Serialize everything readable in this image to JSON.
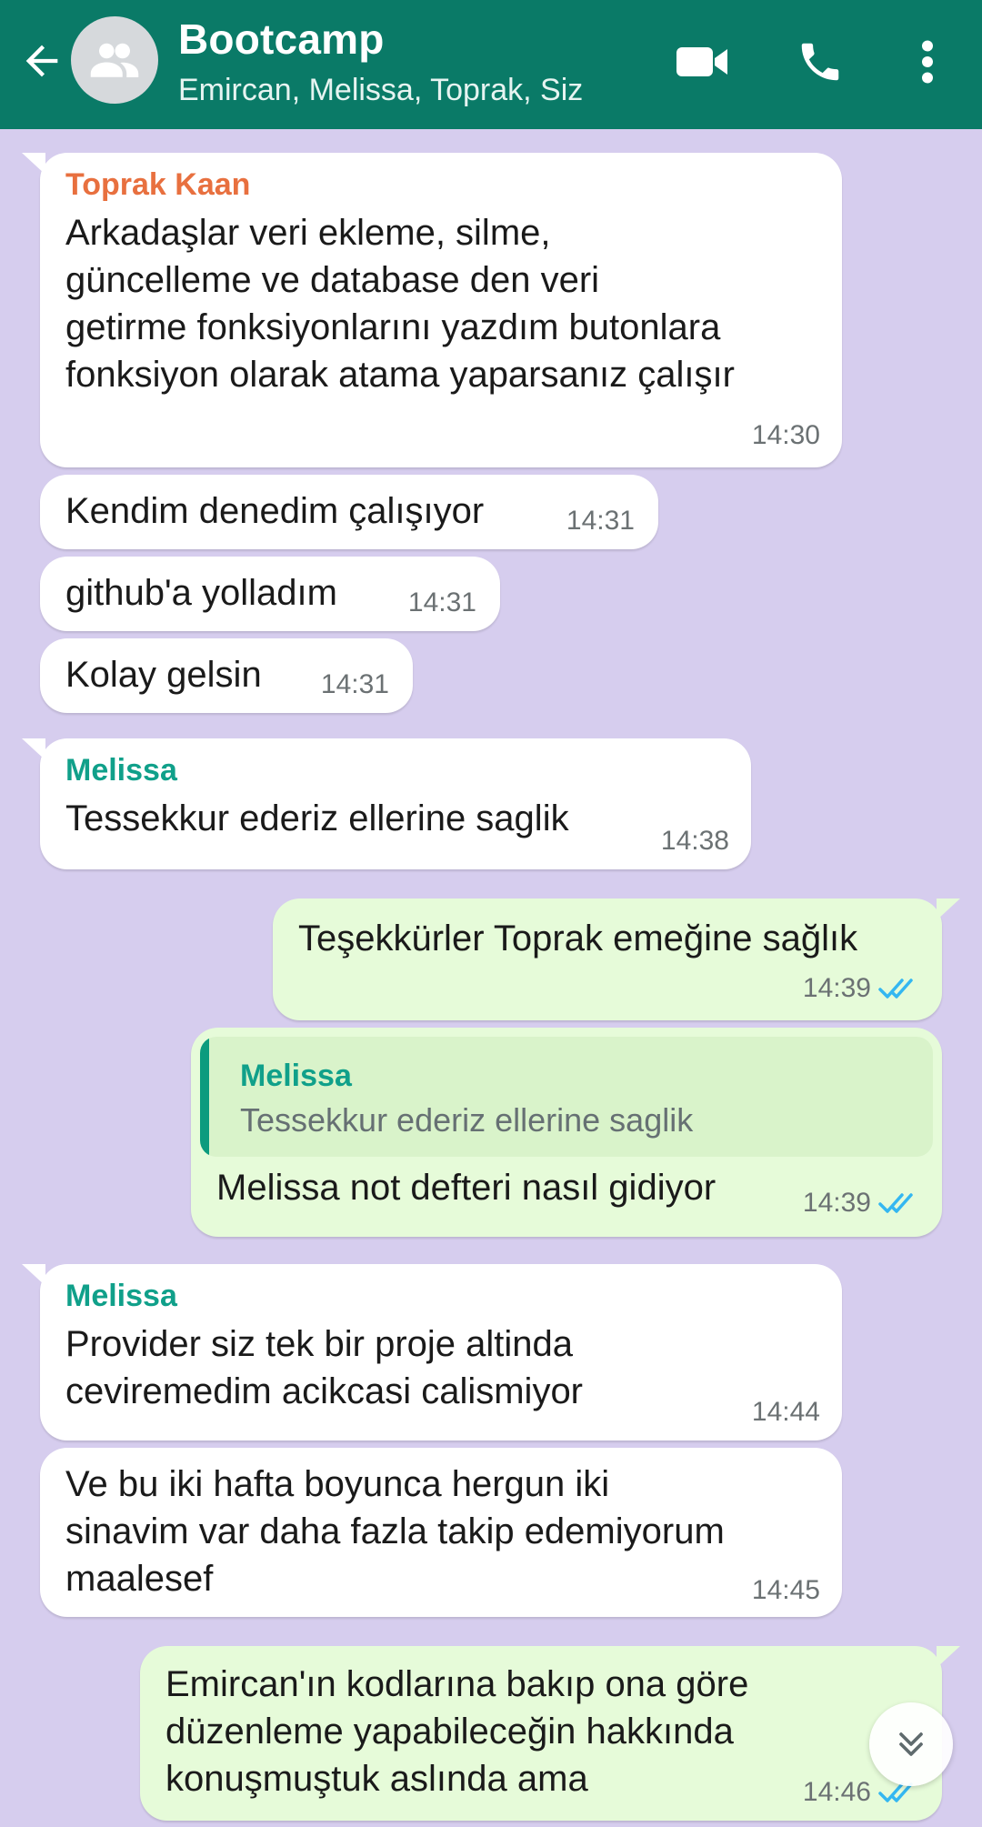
{
  "header": {
    "title": "Bootcamp",
    "subtitle": "Emircan, Melissa, Toprak, Siz",
    "accent": "#0a7a67"
  },
  "icons": [
    "back-arrow-icon",
    "group-avatar-icon",
    "video-call-icon",
    "phone-icon",
    "more-options-icon",
    "double-check-icon",
    "scroll-down-icon"
  ],
  "colors": {
    "chat_bg": "#d6cdee",
    "incoming": "#ffffff",
    "outgoing": "#e6fbd9",
    "toprak": "#e8703f",
    "melissa": "#10a08a",
    "tick": "#34b7f1"
  },
  "messages": [
    {
      "sender": "Toprak Kaan",
      "lines": [
        "Arkadaşlar veri ekleme, silme,",
        "güncelleme ve database den veri",
        "getirme fonksiyonlarını yazdım butonlara",
        "fonksiyon olarak atama yaparsanız çalışır"
      ],
      "time": "14:30"
    },
    {
      "text": "Kendim denedim çalışıyor",
      "time": "14:31"
    },
    {
      "text": "github'a yolladım",
      "time": "14:31"
    },
    {
      "text": "Kolay gelsin",
      "time": "14:31"
    },
    {
      "sender": "Melissa",
      "text": "Tessekkur ederiz ellerine saglik",
      "time": "14:38"
    },
    {
      "text": "Teşekkürler Toprak emeğine sağlık",
      "time": "14:39"
    },
    {
      "reply_sender": "Melissa",
      "reply_text": "Tessekkur ederiz ellerine saglik",
      "text": "Melissa not defteri nasıl gidiyor",
      "time": "14:39"
    },
    {
      "sender": "Melissa",
      "lines": [
        "Provider siz tek bir proje altinda",
        "ceviremedim acikcasi calismiyor"
      ],
      "time": "14:44"
    },
    {
      "lines": [
        "Ve bu iki hafta boyunca hergun iki",
        "sinavim var daha fazla takip edemiyorum",
        "maalesef"
      ],
      "time": "14:45"
    },
    {
      "lines": [
        "Emircan'ın kodlarına bakıp ona göre",
        "düzenleme yapabileceğin hakkında",
        "konuşmuştuk aslında ama"
      ],
      "time": "14:46"
    }
  ]
}
